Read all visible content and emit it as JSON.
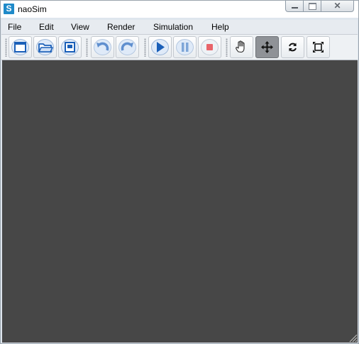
{
  "window": {
    "title": "naoSim",
    "app_icon_letter": "S",
    "close_glyph": "✕"
  },
  "menubar": {
    "items": [
      "File",
      "Edit",
      "View",
      "Render",
      "Simulation",
      "Help"
    ]
  },
  "toolbar": {
    "groups": [
      [
        "new-document-icon",
        "open-folder-icon",
        "save-icon"
      ],
      [
        "undo-icon",
        "redo-icon"
      ],
      [
        "play-icon",
        "pause-icon",
        "stop-icon"
      ],
      [
        "hand-pan-icon",
        "move-arrows-icon",
        "rotate-icon",
        "fit-view-icon"
      ]
    ],
    "active_tool": "move-arrows-icon"
  },
  "colors": {
    "viewport_bg": "#474747",
    "accent_blue": "#1a5fb8",
    "stop_red": "#e8646a",
    "app_icon_bg": "#1f8ac9"
  }
}
